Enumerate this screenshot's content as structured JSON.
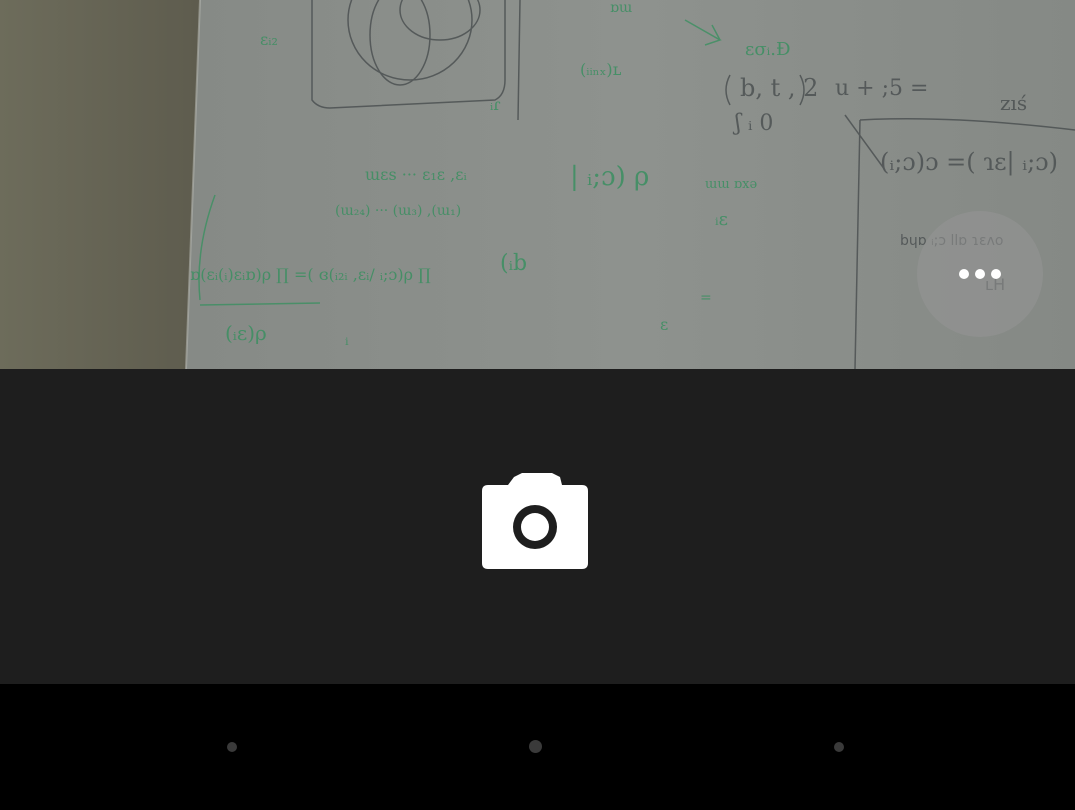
{
  "app": {
    "name": "Camera"
  },
  "viewfinder": {
    "scene": "whiteboard-with-handwritten-equations",
    "colors": {
      "wall": "#6f6e5e",
      "board": "#858a84",
      "green_ink": "#3f8f63",
      "dark_ink": "#4a4f50"
    }
  },
  "overlay": {
    "more_button": {
      "icon": "more-horizontal-icon",
      "dots": 3
    }
  },
  "controls": {
    "background": "#1e1e1e",
    "shutter": {
      "icon": "camera-icon",
      "color": "#ffffff"
    }
  },
  "navbar": {
    "background": "#000000",
    "items": [
      {
        "name": "back",
        "icon": "dot-icon"
      },
      {
        "name": "home",
        "icon": "dot-icon"
      },
      {
        "name": "recents",
        "icon": "dot-icon"
      }
    ]
  }
}
